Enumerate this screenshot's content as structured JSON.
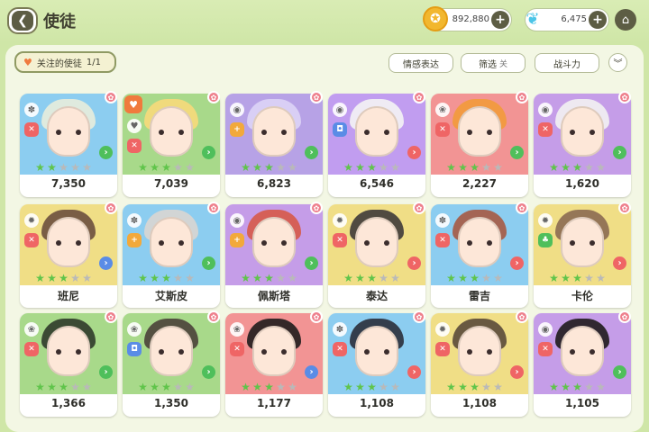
{
  "header": {
    "title": "使徒",
    "back_icon": "back-arrow-icon",
    "home_icon": "home-icon"
  },
  "currencies": [
    {
      "icon": "gold-coin-icon",
      "value": "892,880",
      "color": "#f2b72e"
    },
    {
      "icon": "butterfly-icon",
      "value": "6,475",
      "color": "#4cc5e8"
    }
  ],
  "toolbar": {
    "favorite_filter_label": "关注的使徒",
    "favorite_filter_count": "1/1",
    "emotion_button": "情感表达",
    "filter_button": "筛选",
    "filter_state": "关",
    "sort_button": "战斗力",
    "collapse_icon": "double-chevron-down-icon"
  },
  "cards": [
    {
      "label": "7,350",
      "bg": "#8ccdf0",
      "hair": "#e8eddc",
      "stars": 2,
      "cls_color": "#ef6565",
      "arrow_color": "#4fbf5b",
      "elem": "✽",
      "cls": "✕",
      "favorite": false
    },
    {
      "label": "7,039",
      "bg": "#a8d98a",
      "hair": "#f7d97a",
      "stars": 3,
      "cls_color": "#ef6565",
      "arrow_color": "#4fbf5b",
      "elem": "♥",
      "cls": "✕",
      "favorite": true
    },
    {
      "label": "6,823",
      "bg": "#b7a2e6",
      "hair": "#ddd4f6",
      "stars": 3,
      "cls_color": "#f2a93b",
      "arrow_color": "#4fbf5b",
      "elem": "◉",
      "cls": "+",
      "favorite": false
    },
    {
      "label": "6,546",
      "bg": "#c19df0",
      "hair": "#f4f4f4",
      "stars": 3,
      "cls_color": "#5a8ce6",
      "arrow_color": "#ef6565",
      "elem": "◉",
      "cls": "◘",
      "favorite": false
    },
    {
      "label": "2,227",
      "bg": "#f29494",
      "hair": "#f29a3a",
      "stars": 3,
      "cls_color": "#ef6565",
      "arrow_color": "#4fbf5b",
      "elem": "❀",
      "cls": "✕",
      "favorite": false
    },
    {
      "label": "1,620",
      "bg": "#c59de8",
      "hair": "#f2f2f2",
      "stars": 3,
      "cls_color": "#ef6565",
      "arrow_color": "#4fbf5b",
      "elem": "◉",
      "cls": "✕",
      "favorite": false
    },
    {
      "label": "班尼",
      "bg": "#f0de86",
      "hair": "#6b4f3e",
      "stars": 3,
      "cls_color": "#ef6565",
      "arrow_color": "#5a8ce6",
      "elem": "✹",
      "cls": "✕",
      "favorite": false
    },
    {
      "label": "艾斯皮",
      "bg": "#8ccdf0",
      "hair": "#d9d6d2",
      "stars": 3,
      "cls_color": "#f2a93b",
      "arrow_color": "#4fbf5b",
      "elem": "✽",
      "cls": "+",
      "favorite": false
    },
    {
      "label": "佩斯塔",
      "bg": "#c59de8",
      "hair": "#d65a48",
      "stars": 3,
      "cls_color": "#f2a93b",
      "arrow_color": "#4fbf5b",
      "elem": "◉",
      "cls": "+",
      "favorite": false
    },
    {
      "label": "泰达",
      "bg": "#f0de86",
      "hair": "#3e3a3a",
      "stars": 3,
      "cls_color": "#ef6565",
      "arrow_color": "#ef6565",
      "elem": "✹",
      "cls": "✕",
      "favorite": false
    },
    {
      "label": "雷吉",
      "bg": "#8ccdf0",
      "hair": "#a65a42",
      "stars": 3,
      "cls_color": "#ef6565",
      "arrow_color": "#ef6565",
      "elem": "✽",
      "cls": "✕",
      "favorite": false
    },
    {
      "label": "卡伦",
      "bg": "#f0de86",
      "hair": "#8b6a52",
      "stars": 3,
      "cls_color": "#4fbf5b",
      "arrow_color": "#ef6565",
      "elem": "✹",
      "cls": "♣",
      "favorite": false
    },
    {
      "label": "1,366",
      "bg": "#a8d98a",
      "hair": "#2f3a2a",
      "stars": 3,
      "cls_color": "#ef6565",
      "arrow_color": "#4fbf5b",
      "elem": "❀",
      "cls": "✕",
      "favorite": false
    },
    {
      "label": "1,350",
      "bg": "#a8d98a",
      "hair": "#4a4038",
      "stars": 3,
      "cls_color": "#5a8ce6",
      "arrow_color": "#4fbf5b",
      "elem": "❀",
      "cls": "◘",
      "favorite": false
    },
    {
      "label": "1,177",
      "bg": "#f29494",
      "hair": "#1f1c1c",
      "stars": 3,
      "cls_color": "#ef6565",
      "arrow_color": "#5a8ce6",
      "elem": "❀",
      "cls": "✕",
      "favorite": false
    },
    {
      "label": "1,108",
      "bg": "#8ccdf0",
      "hair": "#2a2f3a",
      "stars": 3,
      "cls_color": "#ef6565",
      "arrow_color": "#ef6565",
      "elem": "✽",
      "cls": "✕",
      "favorite": false
    },
    {
      "label": "1,108",
      "bg": "#f0de86",
      "hair": "#5a4a3a",
      "stars": 3,
      "cls_color": "#ef6565",
      "arrow_color": "#ef6565",
      "elem": "✹",
      "cls": "✕",
      "favorite": false
    },
    {
      "label": "1,105",
      "bg": "#c59de8",
      "hair": "#1f1c1c",
      "stars": 3,
      "cls_color": "#ef6565",
      "arrow_color": "#4fbf5b",
      "elem": "◉",
      "cls": "✕",
      "favorite": false
    }
  ]
}
